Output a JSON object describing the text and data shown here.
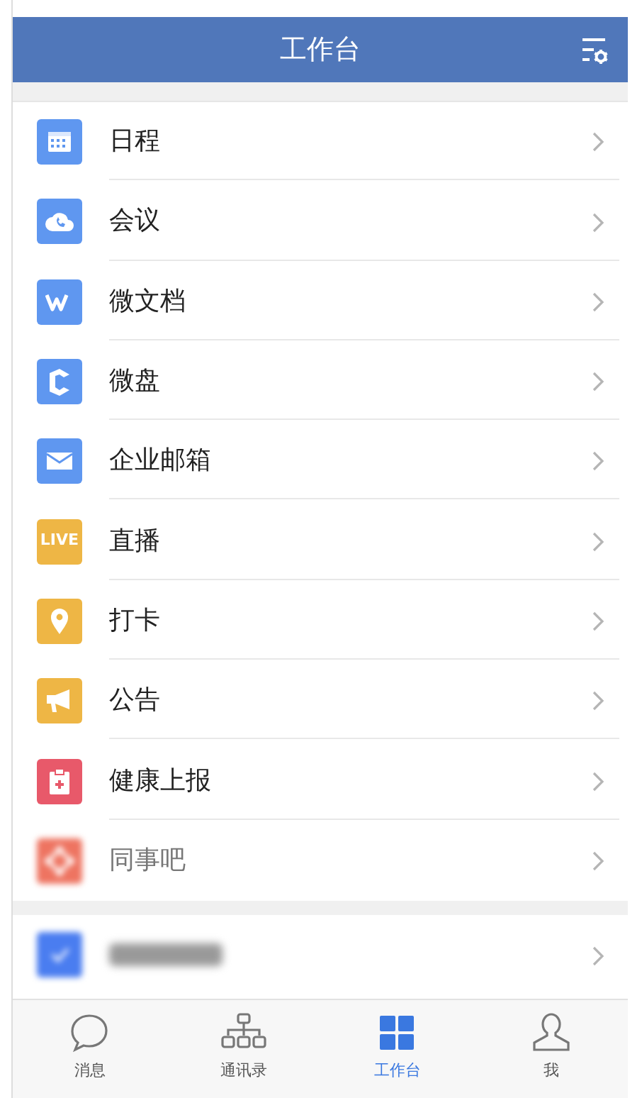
{
  "header": {
    "title": "工作台"
  },
  "groups": [
    {
      "items": [
        {
          "label": "日程",
          "color": "#5f97f0",
          "blurred": false
        },
        {
          "label": "会议",
          "color": "#5f97f0",
          "blurred": false
        },
        {
          "label": "微文档",
          "color": "#5f97f0",
          "blurred": false
        },
        {
          "label": "微盘",
          "color": "#5f97f0",
          "blurred": false
        },
        {
          "label": "企业邮箱",
          "color": "#5f97f0",
          "blurred": false
        },
        {
          "label": "直播",
          "color": "#eeb645",
          "blurred": false,
          "badge": "LIVE"
        },
        {
          "label": "打卡",
          "color": "#eeb645",
          "blurred": false
        },
        {
          "label": "公告",
          "color": "#eeb645",
          "blurred": false
        },
        {
          "label": "健康上报",
          "color": "#e8596a",
          "blurred": false
        },
        {
          "label": "同事吧",
          "color": "#ee7461",
          "blurred": true
        }
      ]
    },
    {
      "items": [
        {
          "color": "#4a7df0",
          "blurred": true
        }
      ]
    }
  ],
  "tab_bar": [
    {
      "label": "消息",
      "selected": false
    },
    {
      "label": "通讯录",
      "selected": false
    },
    {
      "label": "工作台",
      "selected": true
    },
    {
      "label": "我",
      "selected": false
    }
  ]
}
